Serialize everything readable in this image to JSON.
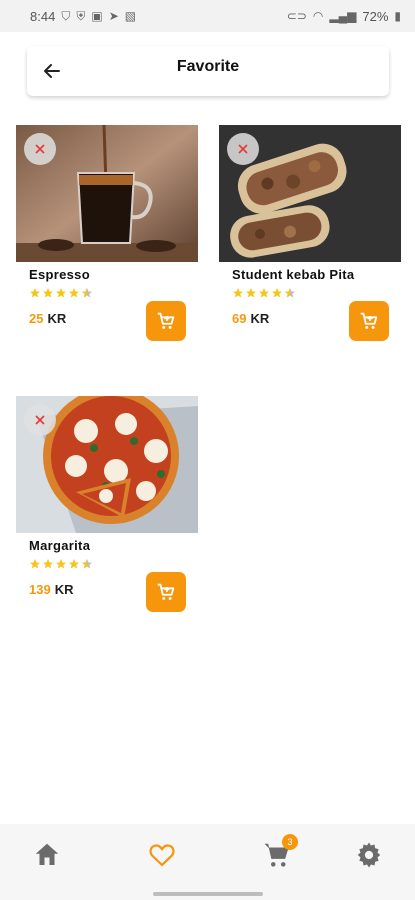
{
  "status_bar": {
    "time": "8:44",
    "battery": "72%"
  },
  "header": {
    "title": "Favorite"
  },
  "products": [
    {
      "name": "Espresso",
      "price": "25",
      "currency": "KR",
      "rating": 4.5
    },
    {
      "name": "Student kebab Pita",
      "price": "69",
      "currency": "KR",
      "rating": 4.5
    },
    {
      "name": "Margarita",
      "price": "139",
      "currency": "KR",
      "rating": 4.5
    }
  ],
  "bottom_nav": {
    "cart_badge": "3",
    "active_tab": "favorites"
  },
  "colors": {
    "accent": "#f5960d",
    "star": "#f5c518",
    "remove": "#e53935"
  }
}
